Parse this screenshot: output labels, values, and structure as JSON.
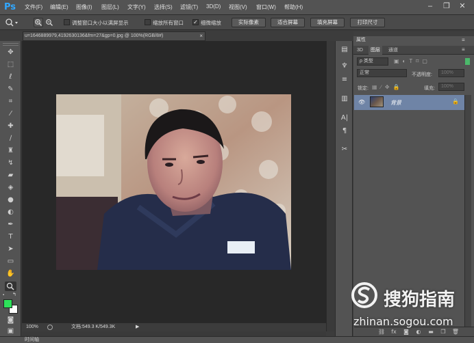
{
  "app": {
    "logo": "Ps"
  },
  "menu": [
    "文件(F)",
    "编辑(E)",
    "图像(I)",
    "图层(L)",
    "文字(Y)",
    "选择(S)",
    "滤镜(T)",
    "3D(D)",
    "视图(V)",
    "窗口(W)",
    "帮助(H)"
  ],
  "window_controls": {
    "minimize": "–",
    "restore": "❐",
    "close": "✕"
  },
  "options": {
    "chk_resize_window": {
      "label": "调整窗口大小以满屏显示",
      "checked": false
    },
    "chk_zoom_all": {
      "label": "缩放所有窗口",
      "checked": false
    },
    "chk_scrubby_zoom": {
      "label": "细微缩放",
      "checked": true
    },
    "btn_actual": "实际像素",
    "btn_fit": "适合屏幕",
    "btn_fill": "填充屏幕",
    "btn_print": "打印尺寸"
  },
  "document": {
    "tab_title": "u=1646889979,4192630136&fm=27&gp=0.jpg @ 100%(RGB/8#)",
    "close": "×"
  },
  "status": {
    "zoom": "100%",
    "doc": "文档:549.3 K/549.3K"
  },
  "timeline": "时间轴",
  "panels": {
    "properties": "属性",
    "tabs": [
      "3D",
      "图层",
      "通道"
    ],
    "active_tab": "图层",
    "filter_kind": "ρ 类型",
    "blend_mode": "正常",
    "opacity_label": "不透明度:",
    "opacity_value": "100%",
    "lock_label": "锁定:",
    "fill_label": "填充:",
    "fill_value": "100%",
    "layer_name": "背景"
  },
  "watermark": {
    "text": "搜狗指南",
    "url": "zhinan.sogou.com"
  },
  "colors": {
    "foreground": "#2ee05a",
    "background": "#ffffff",
    "accent": "#31a8ff",
    "layer_selected": "#6f84a6"
  }
}
